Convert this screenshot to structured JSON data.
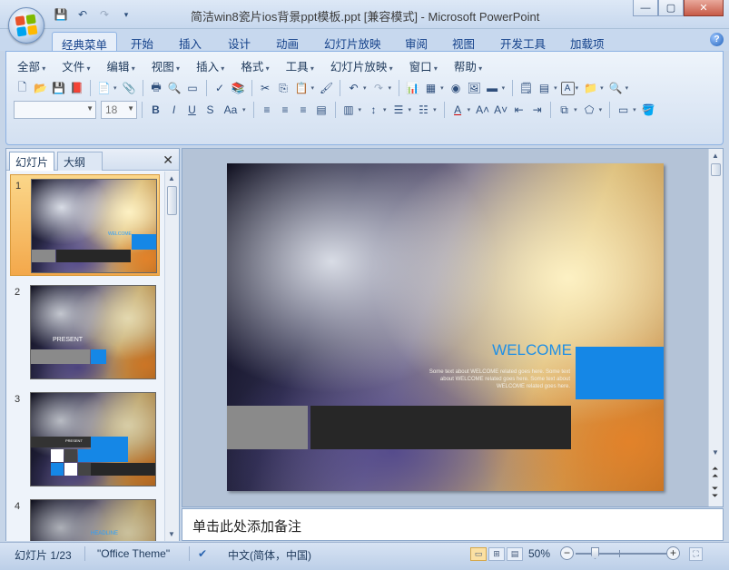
{
  "window": {
    "title": "简洁win8瓷片ios背景ppt模板.ppt [兼容模式] - Microsoft PowerPoint",
    "controls": {
      "minimize": "—",
      "maximize": "▢",
      "close": "✕"
    }
  },
  "qat": {
    "save": "💾",
    "undo": "↶",
    "redo": "↷",
    "customize": "▾"
  },
  "ribbon": {
    "tabs": [
      "经典菜单",
      "开始",
      "插入",
      "设计",
      "动画",
      "幻灯片放映",
      "审阅",
      "视图",
      "开发工具",
      "加载项"
    ],
    "active_tab": "经典菜单",
    "menus": [
      "全部",
      "文件",
      "编辑",
      "视图",
      "插入",
      "格式",
      "工具",
      "幻灯片放映",
      "窗口",
      "帮助"
    ],
    "font_size": "18",
    "font_name": ""
  },
  "left_panel": {
    "tabs": [
      "幻灯片",
      "大纲"
    ],
    "close_glyph": "✕",
    "thumbnails": [
      {
        "num": "1",
        "label": "WELCOME"
      },
      {
        "num": "2",
        "label": "PRESENT"
      },
      {
        "num": "3",
        "label": "PRESENT"
      },
      {
        "num": "4",
        "label": "HEADLINE"
      }
    ]
  },
  "slide": {
    "heading": "WELCOME",
    "body": "Some text about WELCOME related goes here. Some text about WELCOME related goes here. Some text about WELCOME related goes here.",
    "colors": {
      "accent_blue": "#1587e6",
      "grey": "#8a8a8a",
      "dark": "#272727"
    }
  },
  "notes": {
    "placeholder": "单击此处添加备注"
  },
  "status": {
    "slide_count": "幻灯片 1/23",
    "theme": "\"Office Theme\"",
    "language": "中文(简体，中国)",
    "zoom": "50%"
  }
}
